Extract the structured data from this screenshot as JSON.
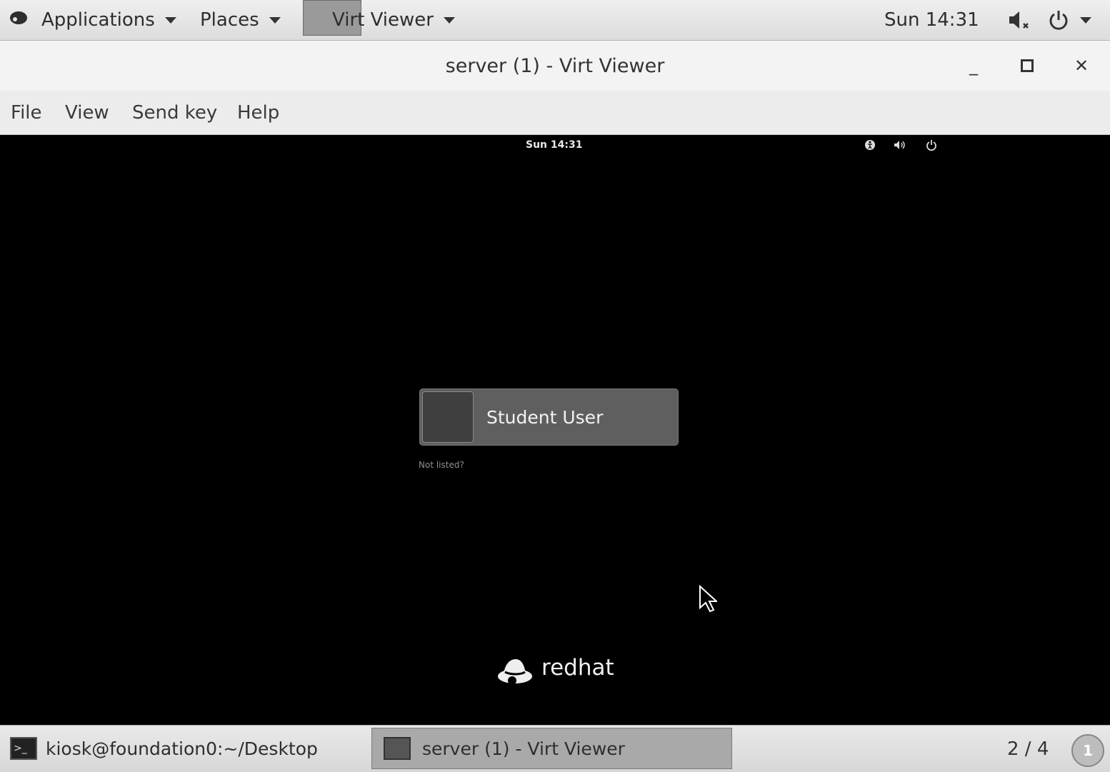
{
  "top_panel": {
    "applications_label": "Applications",
    "places_label": "Places",
    "active_app_label": "Virt Viewer",
    "clock": "Sun 14:31"
  },
  "window": {
    "title": "server (1) - Virt Viewer",
    "menu": [
      "File",
      "View",
      "Send key",
      "Help"
    ]
  },
  "guest": {
    "clock": "Sun 14:31",
    "user_name": "Student User",
    "not_listed": "Not listed?",
    "logo_text": "redhat"
  },
  "taskbar": {
    "tasks": [
      {
        "label": "kiosk@foundation0:~/Desktop",
        "icon": "terminal-icon"
      },
      {
        "label": "server (1) - Virt Viewer",
        "icon": "monitor-icon",
        "active": true
      }
    ],
    "workspace": "2 / 4",
    "notification_count": "1"
  },
  "colors": {
    "panel_bg": "#dcdcdc",
    "guest_bg": "#000000",
    "user_card_bg": "#5f5f5f"
  }
}
